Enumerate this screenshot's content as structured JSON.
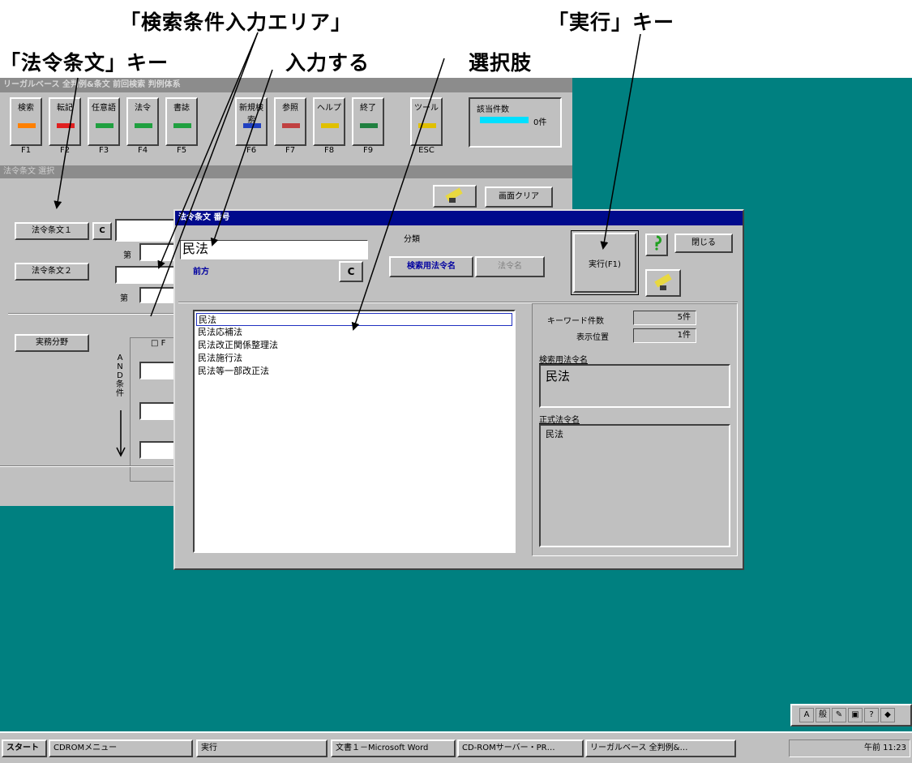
{
  "annotations": {
    "search_area": "「検索条件入力エリア」",
    "execute_key": "「実行」キー",
    "law_article_key": "「法令条文」キー",
    "input": "入力する",
    "choices": "選択肢"
  },
  "main_window": {
    "title": "リーガルベース 全判例&条文 前回検索 判例体系",
    "toolbar": [
      {
        "label": "検索",
        "fkey": "F1",
        "icon": "search-icon"
      },
      {
        "label": "転記",
        "fkey": "F2",
        "icon": "transcribe-icon"
      },
      {
        "label": "任意語",
        "fkey": "F3",
        "icon": "keyword-icon"
      },
      {
        "label": "法令",
        "fkey": "F4",
        "icon": "law-icon"
      },
      {
        "label": "書誌",
        "fkey": "F5",
        "icon": "bibliography-icon"
      },
      {
        "label": "新規検索",
        "fkey": "F6",
        "icon": "new-search-icon"
      },
      {
        "label": "参照",
        "fkey": "F7",
        "icon": "glasses-icon"
      },
      {
        "label": "ヘルプ",
        "fkey": "F8",
        "icon": "help-icon"
      },
      {
        "label": "終了",
        "fkey": "F9",
        "icon": "exit-icon"
      },
      {
        "label": "ツール",
        "fkey": "ESC",
        "icon": "tool-icon"
      }
    ],
    "hit_count_label": "該当件数",
    "hit_count_value": "0件",
    "section_title": "法令条文 選択",
    "clear_screen_button": "画面クリア",
    "law_article_1_button": "法令条文１",
    "law_article_2_button": "法令条文２",
    "c_button": "C",
    "article_label": "第",
    "practice_field_button": "実務分野",
    "and_condition_label": "AND条件",
    "checkbox_label": "□ F"
  },
  "dialog": {
    "title": "法令条文 番号",
    "input_value": "民法",
    "match_label": "前方",
    "c_button": "C",
    "category_label": "分類",
    "search_law_name_button": "検索用法令名",
    "law_name_button": "法令名",
    "execute_button": "実行(F1)",
    "close_button": "閉じる",
    "list_items": [
      "民法",
      "民法応補法",
      "民法改正関係整理法",
      "民法施行法",
      "民法等一部改正法"
    ],
    "keyword_count_label": "キーワード件数",
    "keyword_count_value": "5件",
    "display_position_label": "表示位置",
    "display_position_value": "1件",
    "search_law_name_label": "検索用法令名",
    "search_law_name_value": "民法",
    "formal_law_name_label": "正式法令名",
    "formal_law_name_value": "民法"
  },
  "taskbar": {
    "start": "スタート",
    "tasks": [
      "CDROMメニュー",
      "実行",
      "文書１－Microsoft Word",
      "CD-ROMサーバー・PR…",
      "リーガルベース 全判例&…"
    ],
    "clock": "午前 11:23"
  },
  "ime": [
    "A",
    "般",
    "✎",
    "▣",
    "?",
    "◆"
  ]
}
